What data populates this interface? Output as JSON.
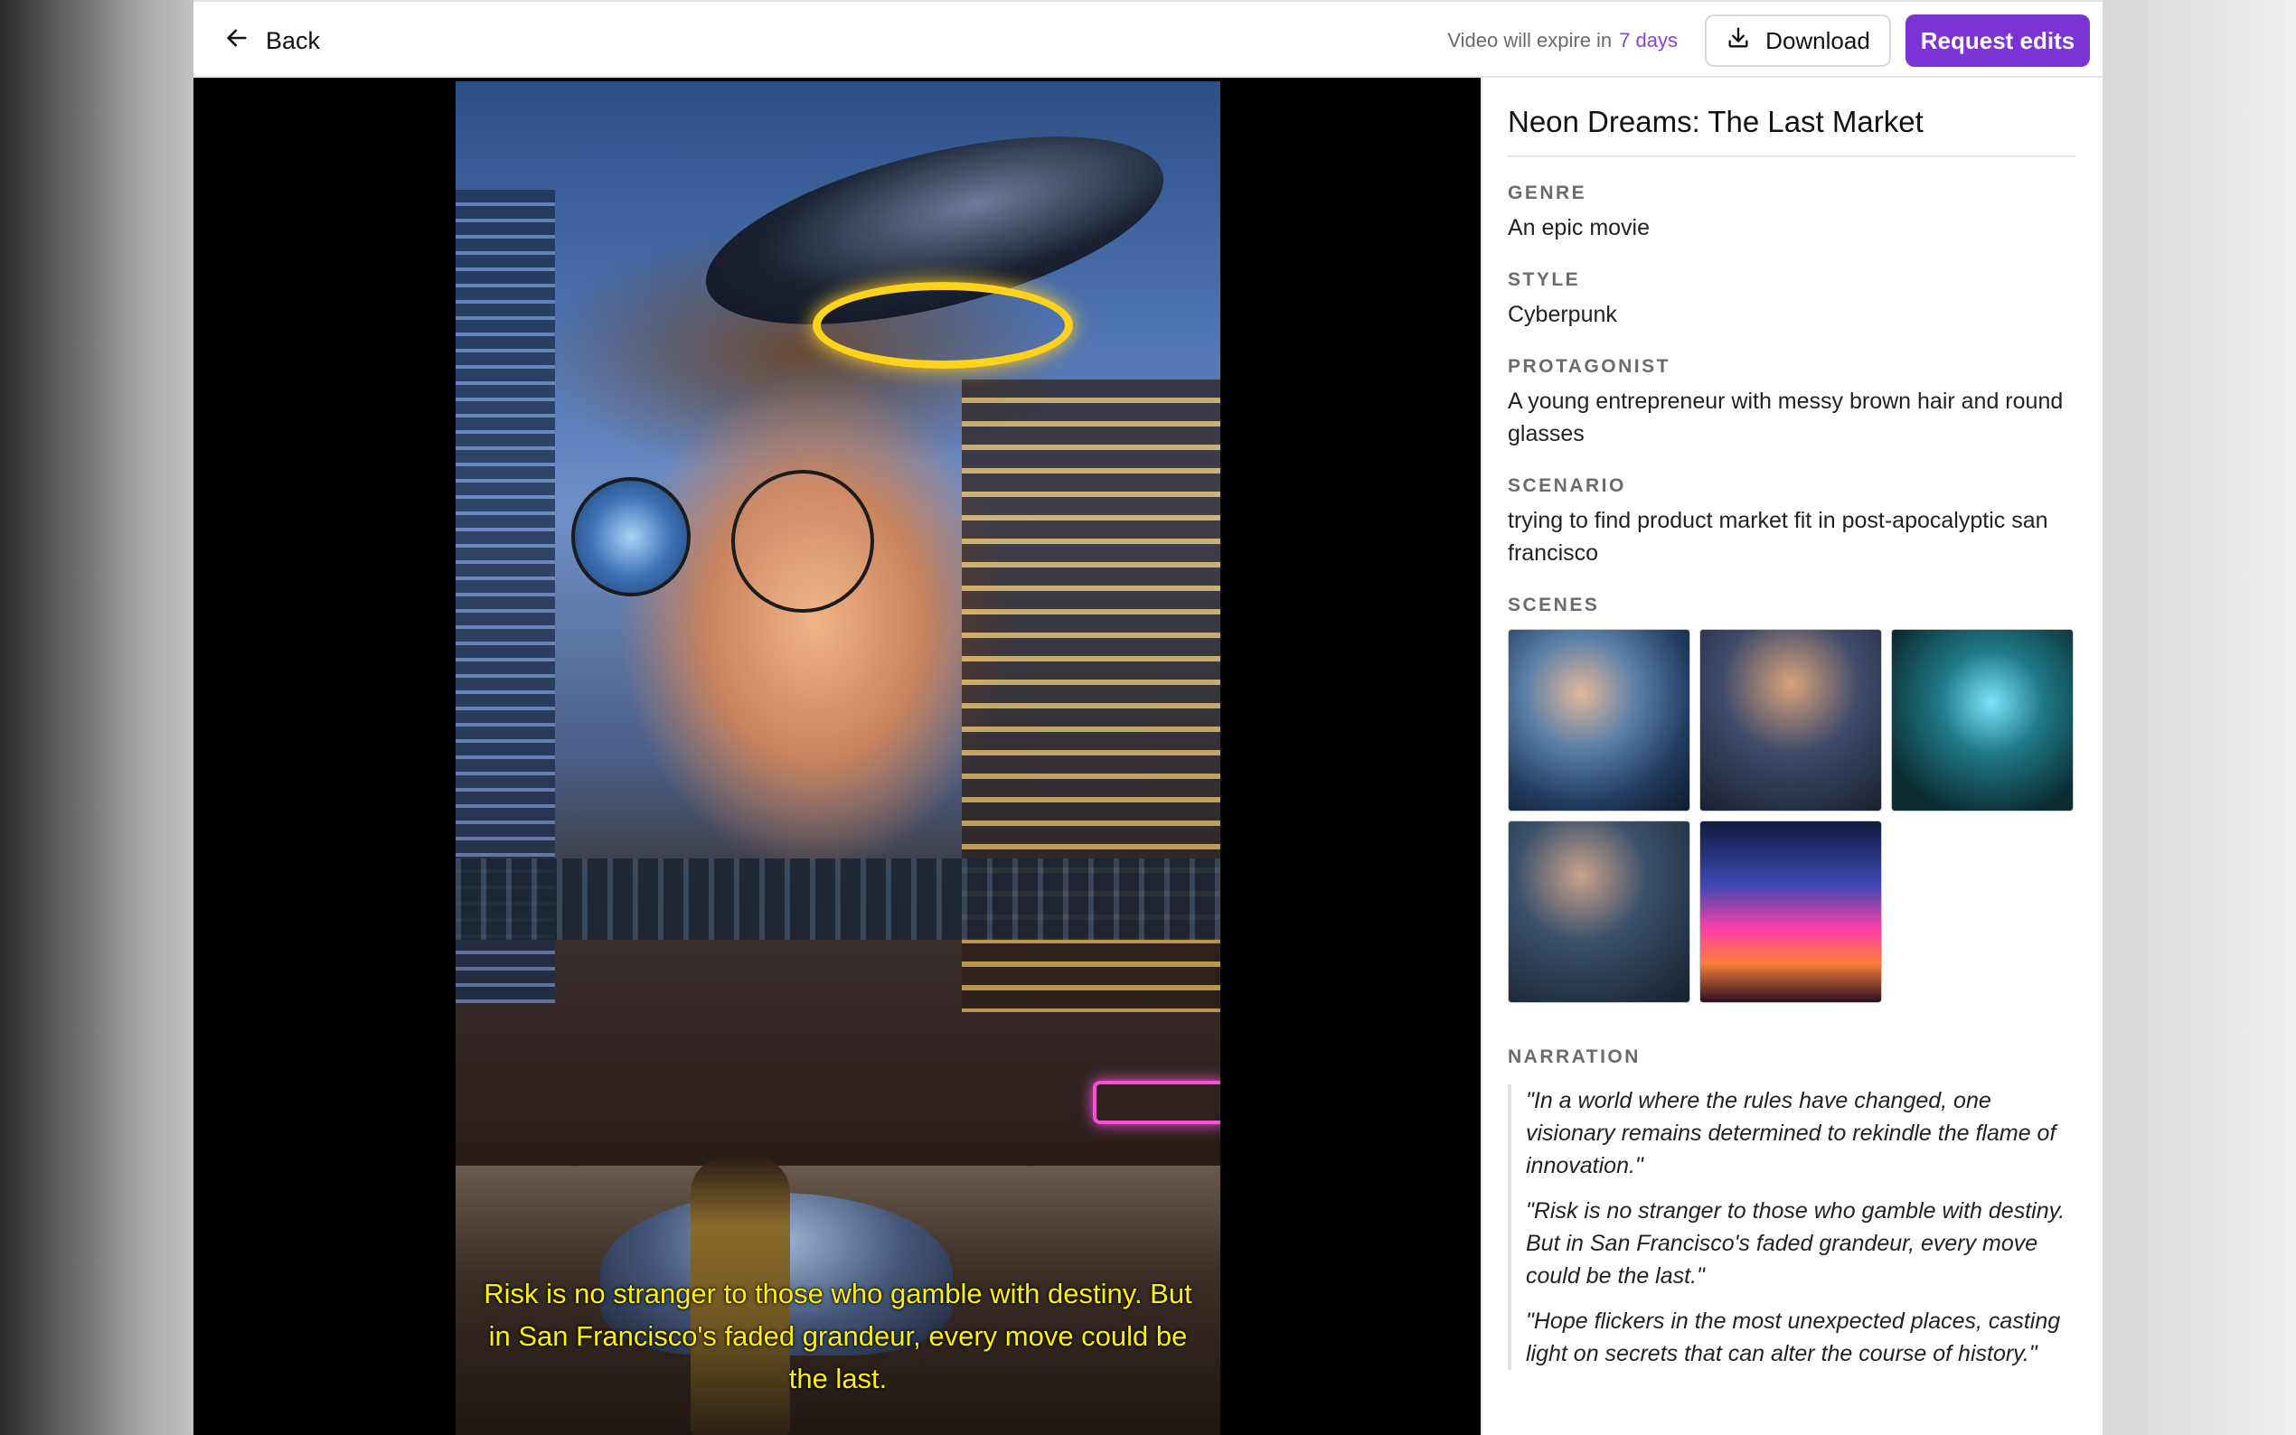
{
  "topbar": {
    "back_label": "Back",
    "expire_prefix": "Video will expire in",
    "expire_days": "7 days",
    "download_label": "Download",
    "request_edits_label": "Request edits"
  },
  "video": {
    "subtitle": "Risk is no stranger to those who gamble with destiny. But in San Francisco's faded grandeur, every move could be the last."
  },
  "details": {
    "title": "Neon Dreams: The Last Market",
    "genre_label": "GENRE",
    "genre": "An epic movie",
    "style_label": "STYLE",
    "style": "Cyberpunk",
    "protagonist_label": "PROTAGONIST",
    "protagonist": "A young entrepreneur with messy brown hair and round glasses",
    "scenario_label": "SCENARIO",
    "scenario": "trying to find product market fit in post-apocalyptic san francisco",
    "scenes_label": "SCENES",
    "scene_count": 5,
    "narration_label": "NARRATION",
    "narration": [
      "\"In a world where the rules have changed, one visionary remains determined to rekindle the flame of innovation.\"",
      "\"Risk is no stranger to those who gamble with destiny. But in San Francisco's faded grandeur, every move could be the last.\"",
      "\"Hope flickers in the most unexpected places, casting light on secrets that can alter the course of history.\""
    ]
  },
  "colors": {
    "accent": "#7c33d4",
    "expire_days": "#8b3fe0",
    "subtitle": "#fff200"
  },
  "icons": {
    "back": "arrow-left-icon",
    "download": "download-icon"
  }
}
